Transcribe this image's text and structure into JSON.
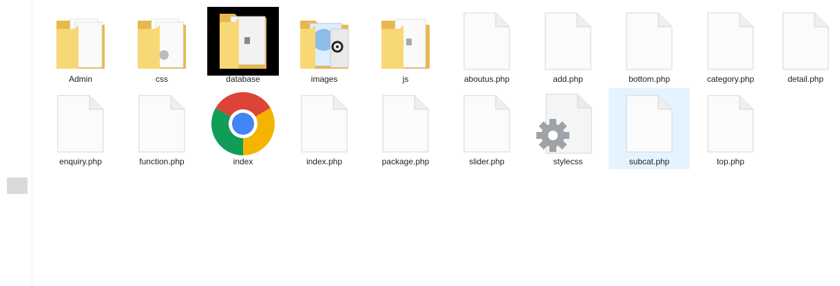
{
  "items_row_1": [
    {
      "label": "Admin",
      "icon": "folder-icon"
    },
    {
      "label": "css",
      "icon": "folder-icon"
    },
    {
      "label": "database",
      "icon": "folder-icon"
    },
    {
      "label": "images",
      "icon": "folder-icon"
    },
    {
      "label": "js",
      "icon": "folder-icon"
    },
    {
      "label": "aboutus.php",
      "icon": "php-file-icon"
    },
    {
      "label": "add.php",
      "icon": "php-file-icon"
    },
    {
      "label": "bottom.php",
      "icon": "php-file-icon"
    },
    {
      "label": "category.php",
      "icon": "php-file-icon"
    },
    {
      "label": "detail.php",
      "icon": "php-file-icon"
    }
  ],
  "items_row_2": [
    {
      "label": "enquiry.php",
      "icon": "php-file-icon"
    },
    {
      "label": "function.php",
      "icon": "php-file-icon"
    },
    {
      "label": "index",
      "icon": "chrome-icon"
    },
    {
      "label": "index.php",
      "icon": "php-file-icon"
    },
    {
      "label": "package.php",
      "icon": "php-file-icon"
    },
    {
      "label": "slider.php",
      "icon": "php-file-icon"
    },
    {
      "label": "stylecss",
      "icon": "settings-file-icon"
    },
    {
      "label": "subcat.php",
      "icon": "php-file-icon",
      "selected": true
    },
    {
      "label": "top.php",
      "icon": "php-file-icon"
    }
  ],
  "colors": {
    "folder": "#f8d775",
    "folder_dark": "#e8b84a",
    "selection": "#e5f3ff",
    "chrome_red": "#db4437",
    "chrome_green": "#0f9d58",
    "chrome_yellow": "#f4b400",
    "chrome_blue": "#4285f4"
  }
}
